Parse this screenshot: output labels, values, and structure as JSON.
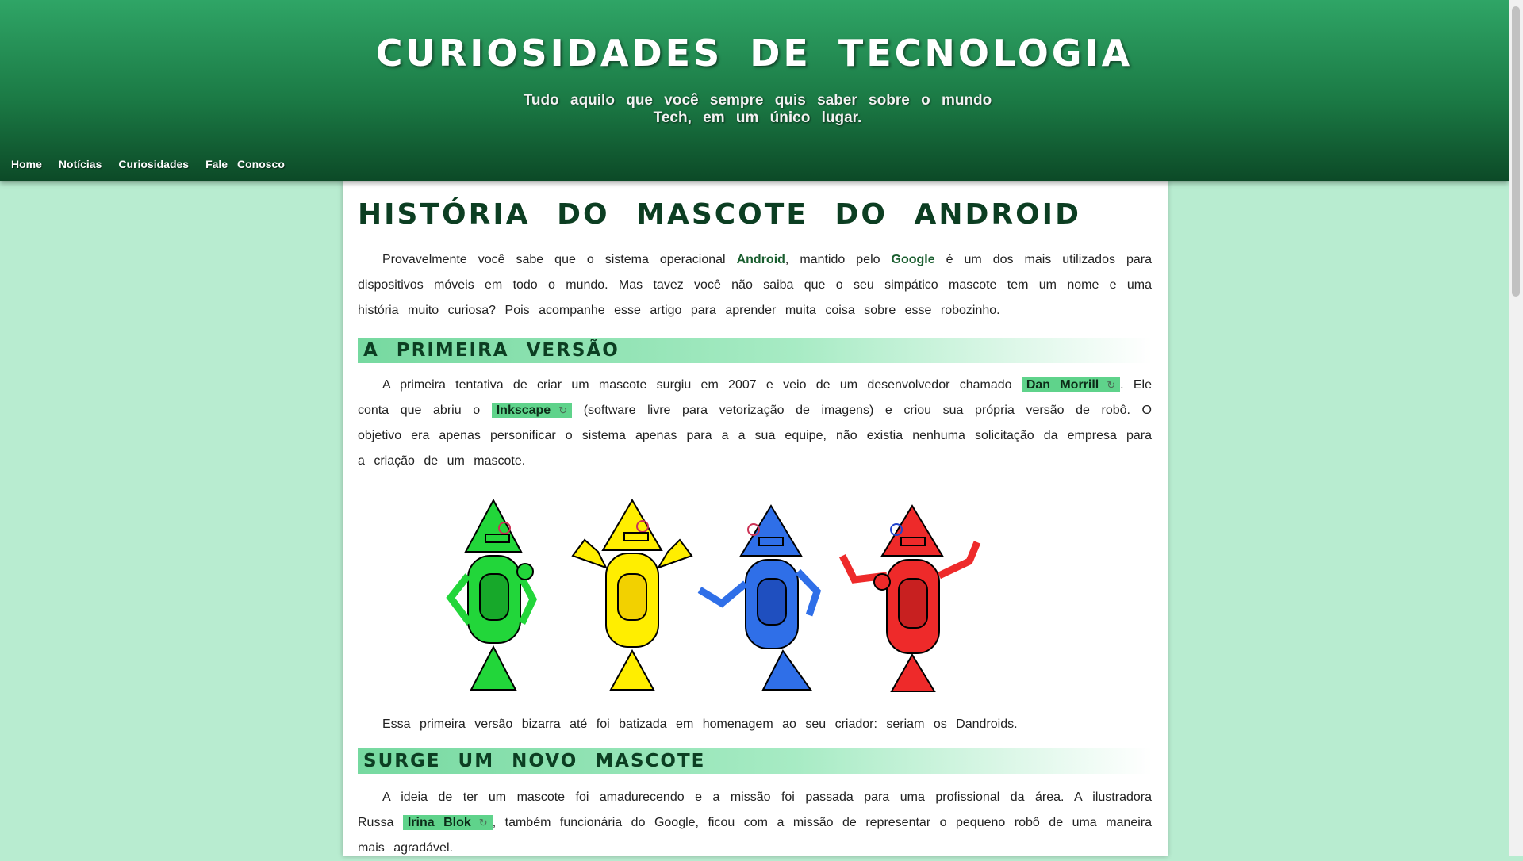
{
  "header": {
    "title": "CURIOSIDADES DE TECNOLOGIA",
    "subtitle": "Tudo aquilo que você sempre quis saber sobre o mundo Tech, em um único lugar."
  },
  "nav": {
    "items": [
      {
        "label": "Home"
      },
      {
        "label": "Notícias"
      },
      {
        "label": "Curiosidades"
      },
      {
        "label": "Fale Conosco"
      }
    ]
  },
  "article": {
    "title": "História do Mascote do Android",
    "intro": {
      "t1": "Provavelmente você sabe que o sistema operacional ",
      "android": "Android",
      "t2": ", mantido pelo ",
      "google": "Google",
      "t3": " é um dos mais utilizados para dispositivos móveis em todo o mundo. Mas tavez você não saiba que o seu simpático mascote tem um nome e uma história muito curiosa? Pois acompanhe esse artigo para aprender muita coisa sobre esse robozinho."
    },
    "section1": {
      "heading": "A Primeira Versão",
      "p1": {
        "t1": "A primeira tentativa de criar um mascote surgiu em 2007 e veio de um desenvolvedor chamado ",
        "link1": "Dan Morrill",
        "t2": ". Ele conta que abriu o ",
        "link2": "Inkscape",
        "t3": " (software livre para vetorização de imagens) e criou sua própria versão de robô. O objetivo era apenas personificar o sistema apenas para a a sua equipe, não existia nenhuma solicitação da empresa para a criação de um mascote."
      },
      "caption": "Essa primeira versão bizarra até foi batizada em homenagem ao seu criador: seriam os Dandroids."
    },
    "section2": {
      "heading": "Surge um Novo Mascote",
      "p1": {
        "t1": "A ideia de ter um mascote foi amadurecendo e a missão foi passada para uma profissional da área. A ilustradora Russa ",
        "link1": "Irina Blok",
        "t2": ", também funcionária do Google, ficou com a missão de representar o pequeno robô de uma maneira mais agradável."
      }
    }
  },
  "colors": {
    "header_top": "#2fa566",
    "header_bottom": "#0c4a27",
    "page_bg": "#b8ecd0",
    "link_chip": "#5fd38b",
    "robots": [
      "#22d63a",
      "#ffee00",
      "#2f6fe8",
      "#ee2a2a"
    ]
  },
  "icons": {
    "external_link": "external-link-icon"
  }
}
